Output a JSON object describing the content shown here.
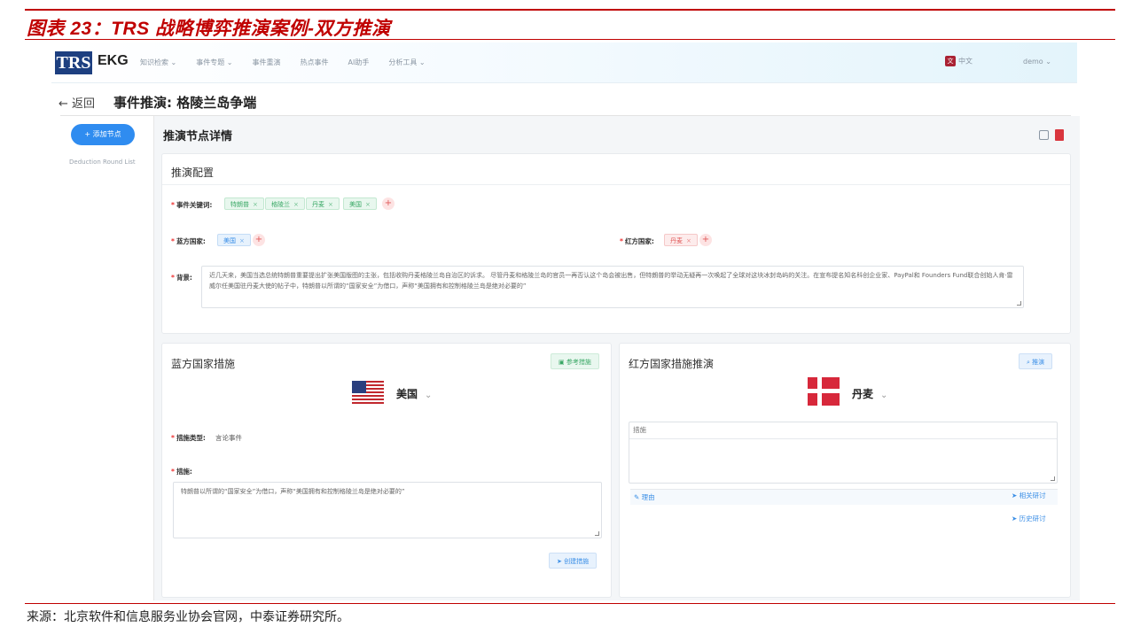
{
  "figure": {
    "title": "图表 23：TRS 战略博弈推演案例-双方推演",
    "source": "来源：北京软件和信息服务业协会官网，中泰证券研究所。"
  },
  "topbar": {
    "logo_box": "TRS",
    "logo_text": "EKG",
    "nav": [
      "知识检索 ⌄",
      "事件专题 ⌄",
      "事件重演",
      "热点事件",
      "AI助手",
      "分析工具 ⌄"
    ],
    "lang": "中文",
    "user": "demo ⌄"
  },
  "header": {
    "back": "← 返回",
    "title": "事件推演: 格陵兰岛争端"
  },
  "sidebar": {
    "add_node": "+ 添加节点",
    "round_list": "Deduction Round List"
  },
  "main": {
    "section_title": "推演节点详情",
    "config": {
      "title": "推演配置",
      "keywords_label": "事件关键词:",
      "keywords": [
        "特朗普",
        "格陵兰",
        "丹麦",
        "美国"
      ],
      "blue_label": "蓝方国家:",
      "blue_tags": [
        "美国"
      ],
      "red_label": "红方国家:",
      "red_tags": [
        "丹麦"
      ],
      "background_label": "背景:",
      "background_text": "近几天来，美国当选总统特朗普重要提出扩张美国版图的主张，包括收购丹麦格陵兰岛自治区的诉求。 尽管丹麦和格陵兰岛的官员一再否认这个岛会被出售，但特朗普的举动无疑再一次唤起了全球对这块冰封岛屿的关注。在宣布提名知名科创企业家、PayPal和 Founders Fund联合创始人肯·雷威尔任美国驻丹麦大使的帖子中，特朗普以所谓的“国家安全”为借口，声称“美国拥有和控制格陵兰岛是绝对必要的”"
    },
    "blue": {
      "title": "蓝方国家措施",
      "ref_btn": "参考措施",
      "country": "美国",
      "type_label": "措施类型:",
      "type_value": "言论事件",
      "measure_label": "措施:",
      "measure_text": "特朗普以所谓的“国家安全”为借口，声称“美国拥有和控制格陵兰岛是绝对必要的”",
      "submit_btn": "创建措施"
    },
    "red": {
      "title": "红方国家措施推演",
      "search_btn": "推演",
      "country": "丹麦",
      "measure_placeholder": "措施",
      "reason": "理由",
      "related": "相关研讨",
      "history": "历史研讨"
    }
  }
}
